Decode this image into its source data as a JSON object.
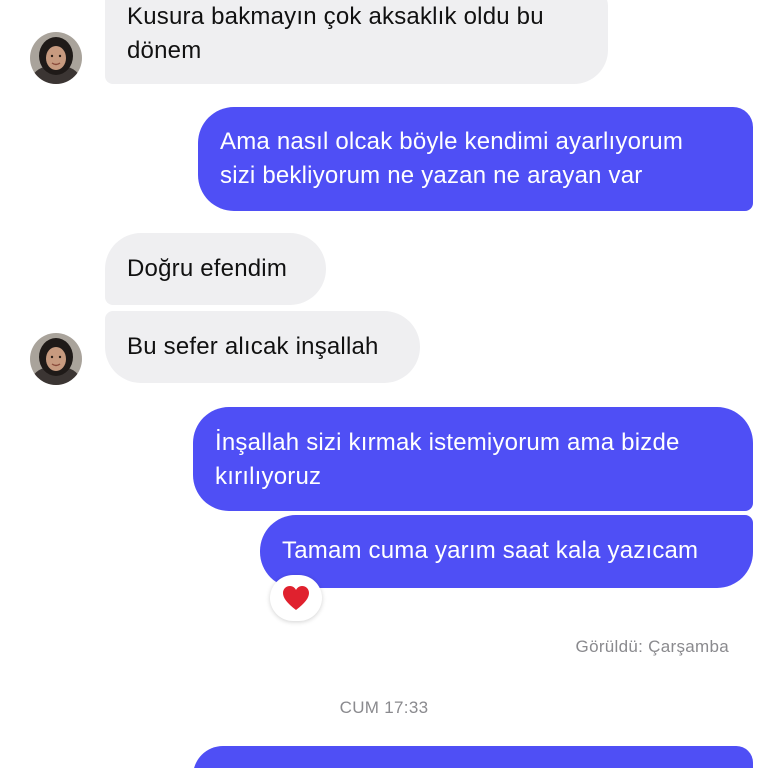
{
  "messages": [
    {
      "direction": "incoming",
      "line1": "Kusura bakmayın çok aksaklık oldu bu",
      "line2": "dönem"
    },
    {
      "direction": "outgoing",
      "line1": "Ama nasıl olcak böyle kendimi ayarlıyorum",
      "line2": "sizi bekliyorum ne yazan ne arayan var"
    },
    {
      "direction": "incoming",
      "line1": "Doğru efendim"
    },
    {
      "direction": "incoming",
      "line1": "Bu sefer alıcak inşallah"
    },
    {
      "direction": "outgoing",
      "line1": "İnşallah sizi kırmak istemiyorum ama bizde",
      "line2": "kırılıyoruz"
    },
    {
      "direction": "outgoing",
      "line1": "Tamam cuma yarım saat kala yazıcam",
      "reaction": "heart"
    }
  ],
  "seen_status": "Görüldü: Çarşamba",
  "timestamp_divider": "CUM 17:33",
  "colors": {
    "outgoing_bubble": "#4f4ff5",
    "incoming_bubble": "#efeff1",
    "meta_text": "#8a8a8e",
    "reaction_heart": "#e0212e"
  }
}
